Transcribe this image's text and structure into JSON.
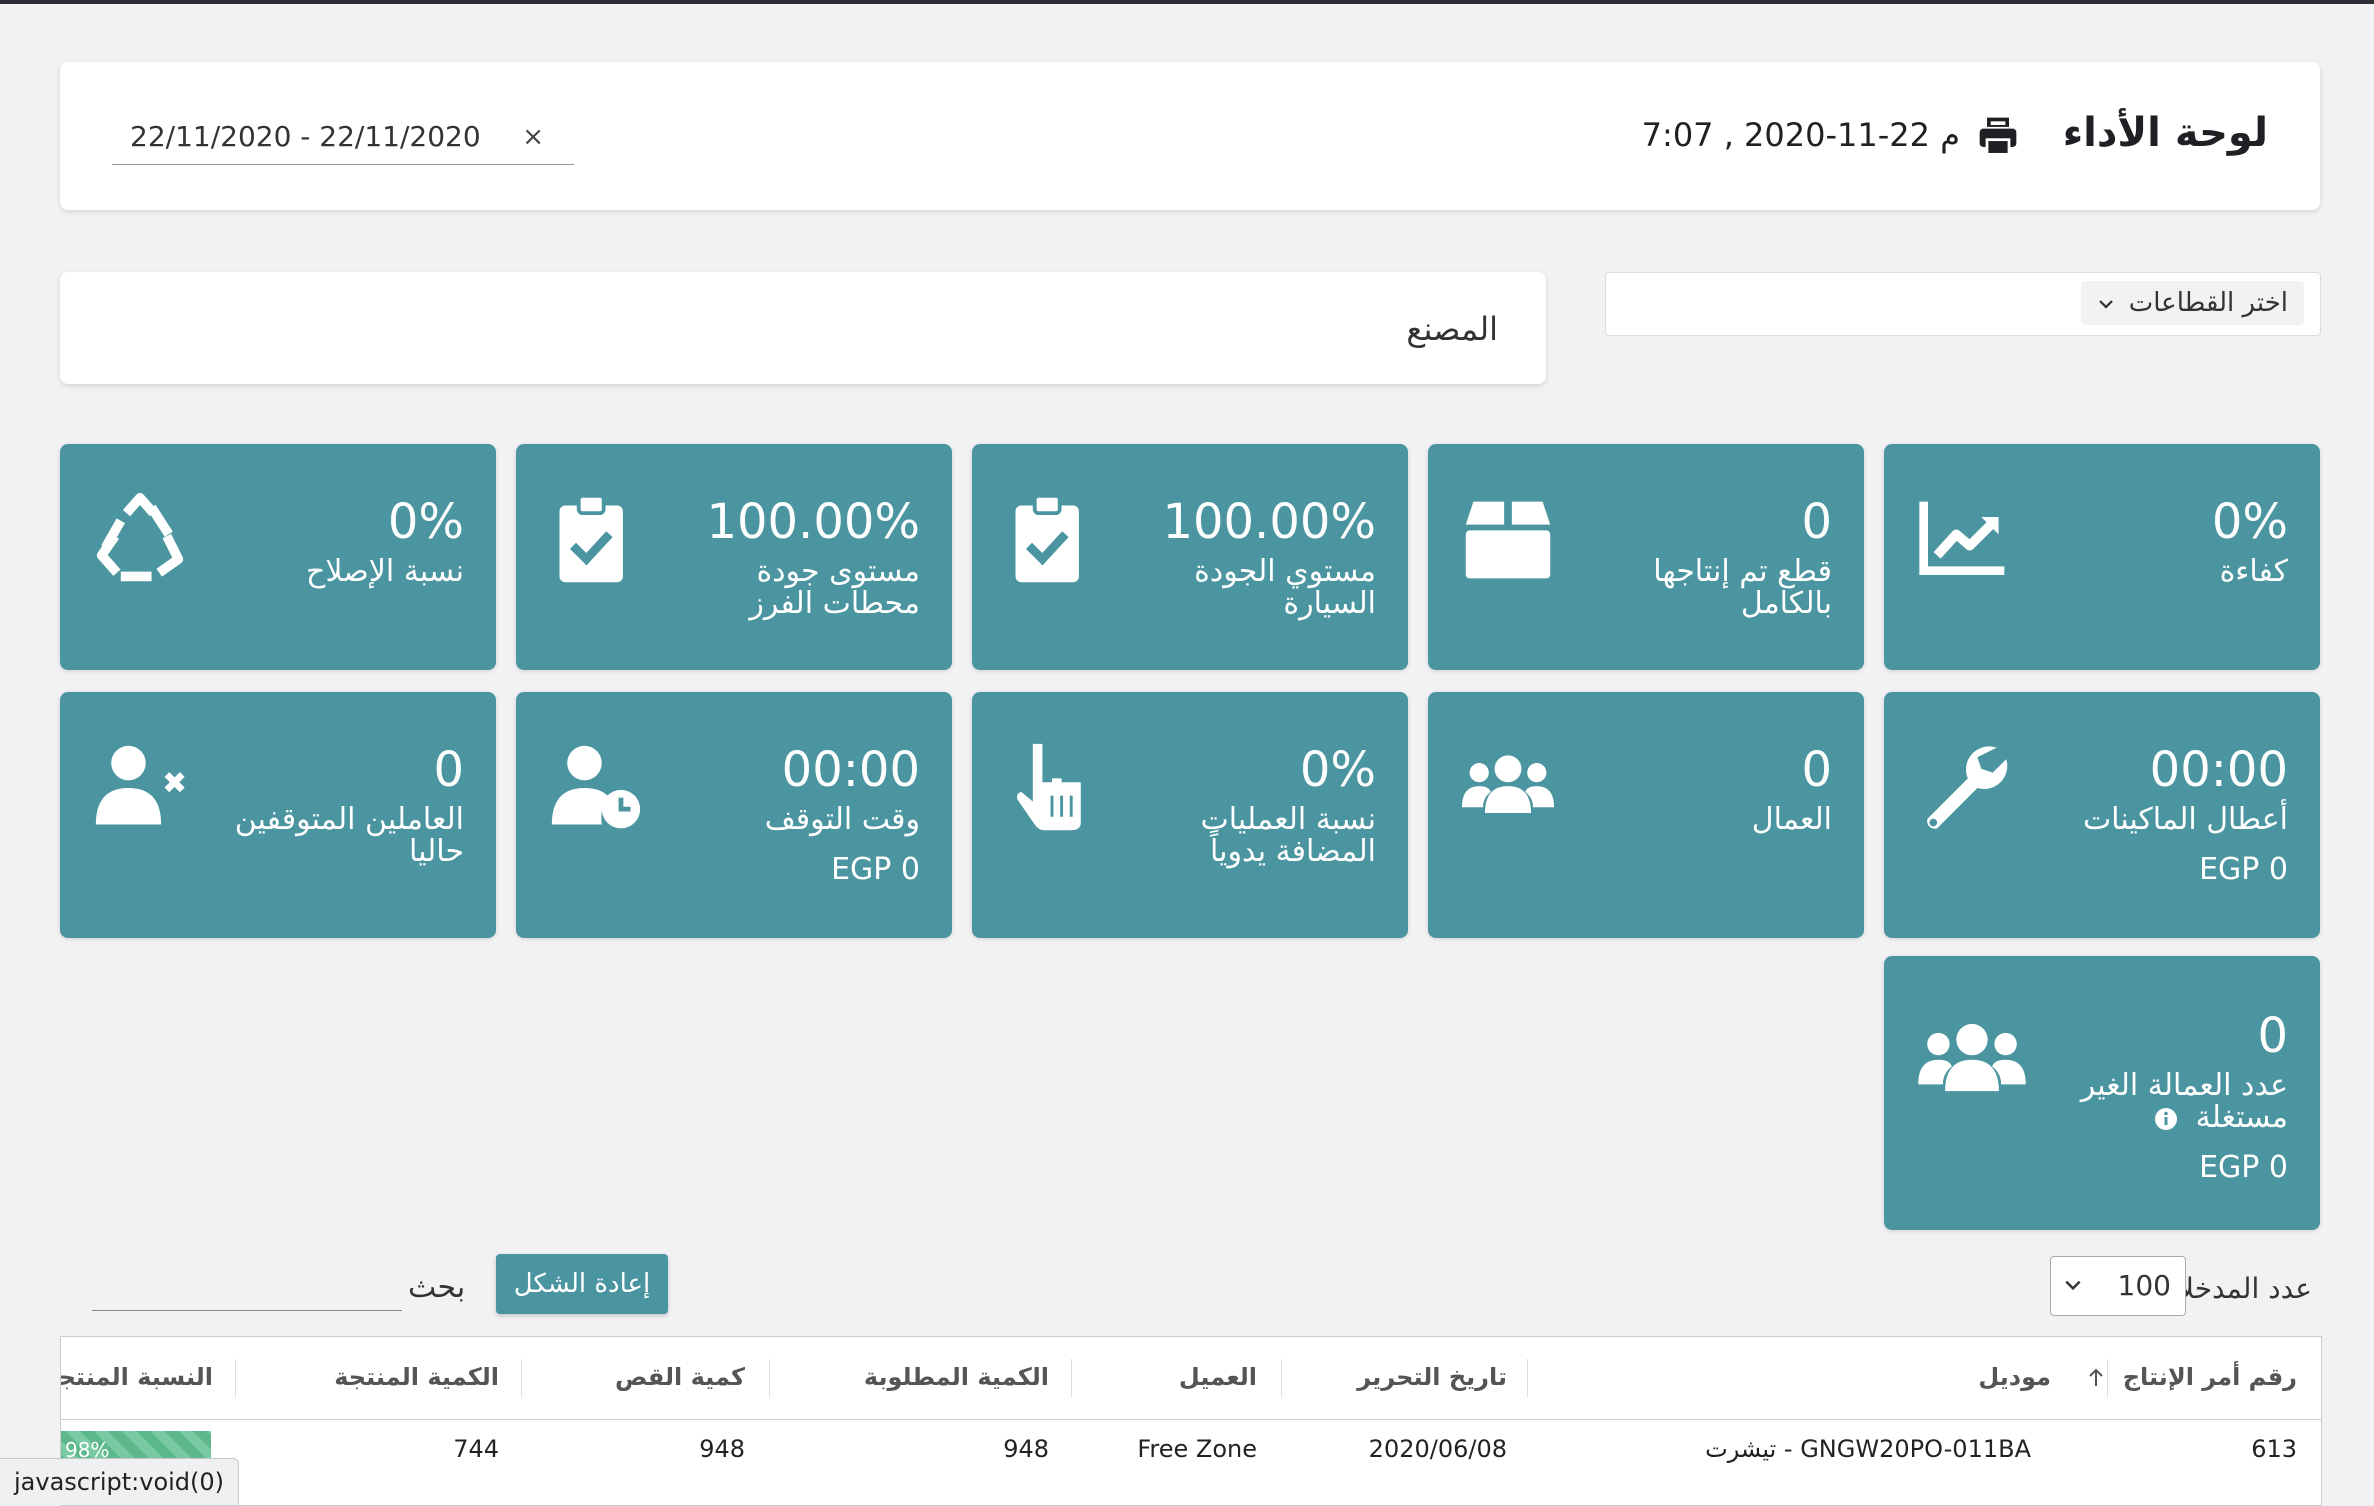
{
  "header": {
    "title": "لوحة الأداء",
    "datetime": "7:07 , 2020-11-22 م",
    "date_range": "22/11/2020  -  22/11/2020",
    "clear_symbol": "×",
    "icons": {
      "print": "printer-icon"
    }
  },
  "sector_select": {
    "label": "اختر القطاعات",
    "icon": "chevron-down-icon"
  },
  "factory_label": "المصنع",
  "tiles": [
    {
      "value": "0%",
      "label": "كفاءة",
      "icon": "chart-line-icon"
    },
    {
      "value": "0",
      "label": "قطع تم إنتاجها بالكامل",
      "icon": "box-icon"
    },
    {
      "value": "100.00%",
      "label": "مستوي الجودة السيارة",
      "icon": "clipboard-check-icon"
    },
    {
      "value": "100.00%",
      "label": "مستوى جودة محطات الفرز",
      "icon": "clipboard-check-icon"
    },
    {
      "value": "0%",
      "label": "نسبة الإصلاح",
      "icon": "recycle-icon"
    },
    {
      "value": "00:00",
      "label": "أعطال الماكينات",
      "sub": "EGP 0",
      "icon": "wrench-icon"
    },
    {
      "value": "0",
      "label": "العمال",
      "icon": "users-icon"
    },
    {
      "value": "0%",
      "label": "نسبة العمليات المضافة يدوياً",
      "icon": "hand-pointer-icon"
    },
    {
      "value": "00:00",
      "label": "وقت التوقف",
      "sub": "EGP 0",
      "icon": "user-clock-icon"
    },
    {
      "value": "0",
      "label": "العاملين المتوقفين حاليا",
      "icon": "user-times-icon"
    },
    {
      "value": "0",
      "label": "عدد العمالة الغير مستغلة",
      "sub": "EGP 0",
      "icon": "users-icon",
      "info_icon": "info-icon"
    }
  ],
  "table_controls": {
    "entries_label": "عدد المدخلات",
    "entries_value": "100",
    "reset_label": "إعادة الشكل",
    "search_label": "بحث"
  },
  "table": {
    "columns": [
      "رقم أمر الإنتاج",
      "موديل",
      "تاريخ التحرير",
      "العميل",
      "الكمية المطلوبة",
      "كمية القص",
      "الكمية المنتجة",
      "النسبة المنتجة"
    ],
    "sort_icon": "sort-up-icon",
    "rows": [
      {
        "order": "613",
        "model": "GNGW20PO-011BA - تيشرت",
        "date": "2020/06/08",
        "client": "Free Zone",
        "required": "948",
        "cut": "948",
        "produced": "744",
        "ratio": "98%"
      }
    ]
  },
  "status_bar": "javascript:void(0)",
  "colors": {
    "tile": "#4a95a0",
    "background": "#f2f2f4",
    "progress": "#5cb88a"
  }
}
